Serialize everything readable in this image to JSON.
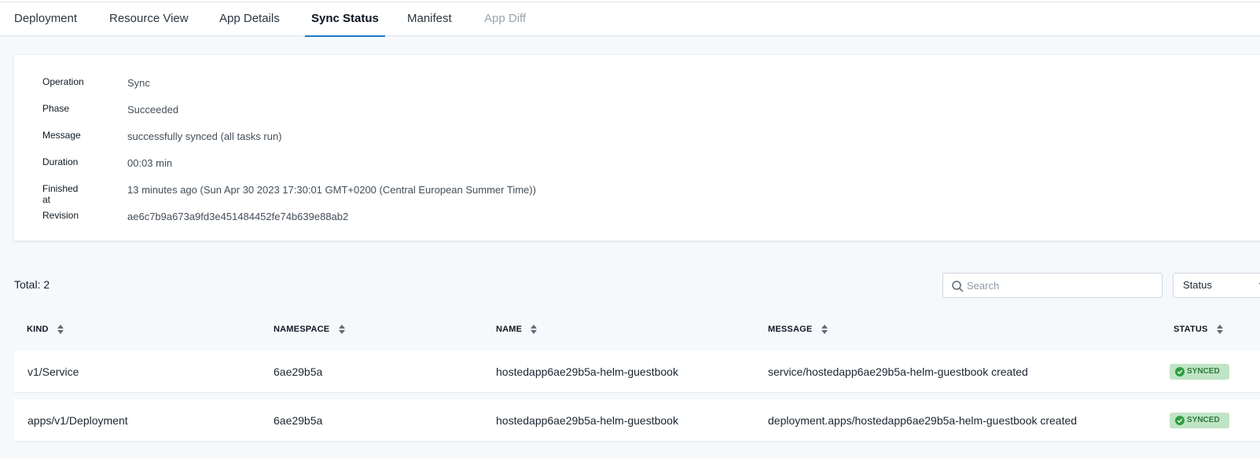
{
  "tabs": [
    {
      "label": "Deployment"
    },
    {
      "label": "Resource View"
    },
    {
      "label": "App Details"
    },
    {
      "label": "Sync Status"
    },
    {
      "label": "Manifest"
    },
    {
      "label": "App Diff"
    }
  ],
  "active_tab": "Sync Status",
  "summary": {
    "operation": {
      "label": "Operation",
      "value": "Sync"
    },
    "phase": {
      "label": "Phase",
      "value": "Succeeded"
    },
    "message": {
      "label": "Message",
      "value": "successfully synced (all tasks run)"
    },
    "duration": {
      "label": "Duration",
      "value": "00:03 min"
    },
    "finished_at": {
      "label": "Finished at",
      "value": "13 minutes ago (Sun Apr 30 2023 17:30:01 GMT+0200 (Central European Summer Time))"
    },
    "revision": {
      "label": "Revision",
      "value": "ae6c7b9a673a9fd3e451484452fe74b639e88ab2"
    }
  },
  "total": "Total: 2",
  "search": {
    "placeholder": "Search",
    "icon": "search-icon"
  },
  "status_filter": {
    "label": "Status",
    "icon": "chevron-down-icon"
  },
  "table": {
    "headers": [
      "KIND",
      "NAMESPACE",
      "NAME",
      "MESSAGE",
      "STATUS"
    ],
    "rows": [
      {
        "kind": "v1/Service",
        "namespace": "6ae29b5a",
        "name": "hostedapp6ae29b5a-helm-guestbook",
        "message": "service/hostedapp6ae29b5a-helm-guestbook created",
        "status": "SYNCED"
      },
      {
        "kind": "apps/v1/Deployment",
        "namespace": "6ae29b5a",
        "name": "hostedapp6ae29b5a-helm-guestbook",
        "message": "deployment.apps/hostedapp6ae29b5a-helm-guestbook created",
        "status": "SYNCED"
      }
    ]
  },
  "colors": {
    "accent": "#1f78c7",
    "synced_bg": "#bfe5c4",
    "synced_text": "#2f7a3c"
  }
}
